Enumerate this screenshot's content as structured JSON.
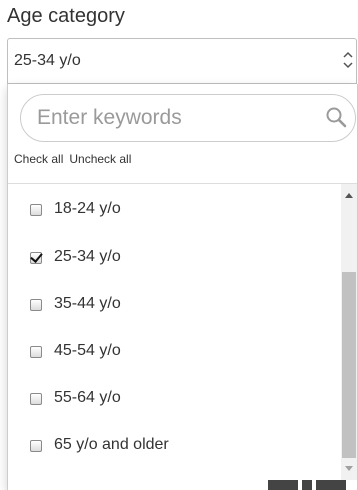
{
  "filter": {
    "label": "Age category",
    "selected_value": "25-34 y/o"
  },
  "search": {
    "placeholder": "Enter keywords",
    "value": ""
  },
  "bulk_actions": {
    "check_all": "Check all",
    "uncheck_all": "Uncheck all"
  },
  "options": [
    {
      "label": "18-24 y/o",
      "checked": false
    },
    {
      "label": "25-34 y/o",
      "checked": true
    },
    {
      "label": "35-44 y/o",
      "checked": false
    },
    {
      "label": "45-54 y/o",
      "checked": false
    },
    {
      "label": "55-64 y/o",
      "checked": false
    },
    {
      "label": "65 y/o and older",
      "checked": false
    }
  ],
  "icons": {
    "select_arrows": "updown-chevron-icon",
    "search": "search-icon"
  },
  "colors": {
    "text": "#333333",
    "border": "#cccccc",
    "placeholder": "#9a9a9a",
    "scrollbar_thumb": "#c1c1c1"
  }
}
